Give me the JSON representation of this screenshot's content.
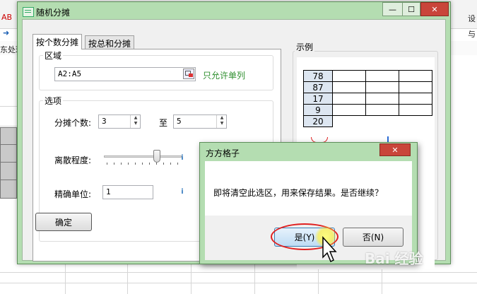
{
  "background": {
    "col_labels": [
      "▾"
    ],
    "row1_text": "AB",
    "row2_text": "➜",
    "row3_text": "东处理",
    "right_text1": "设",
    "right_text2": "与"
  },
  "dialog": {
    "title": "随机分摊",
    "minimize_symbol": "—",
    "maximize_symbol": "☐",
    "close_symbol": "✕",
    "tabs": [
      {
        "label": "按个数分摊",
        "active": true
      },
      {
        "label": "按总和分摊",
        "active": false
      }
    ],
    "region": {
      "label": "区域",
      "value": "A2:A5",
      "hint": "只允许单列"
    },
    "options": {
      "label": "选项",
      "count_label": "分摊个数:",
      "count_from": "3",
      "to_label": "至",
      "count_to": "5",
      "dispersion_label": "离散程度:",
      "dispersion_level": 0.7,
      "precision_label": "精确单位:",
      "precision_value": "1"
    },
    "confirm_label": "确定",
    "example": {
      "label": "示例",
      "values": [
        "78",
        "87",
        "17",
        "9",
        "20"
      ]
    }
  },
  "message": {
    "title": "方方格子",
    "close_symbol": "✕",
    "text": "即将清空此选区，用来保存结果。是否继续？",
    "yes_label": "是(Y)",
    "no_label": "否(N)"
  },
  "watermark": "Bai 经验",
  "colors": {
    "frame_green": "#b4ddb1",
    "close_red": "#c9453a",
    "hint_green": "#2f8f2f",
    "highlight_red": "#e02020"
  }
}
